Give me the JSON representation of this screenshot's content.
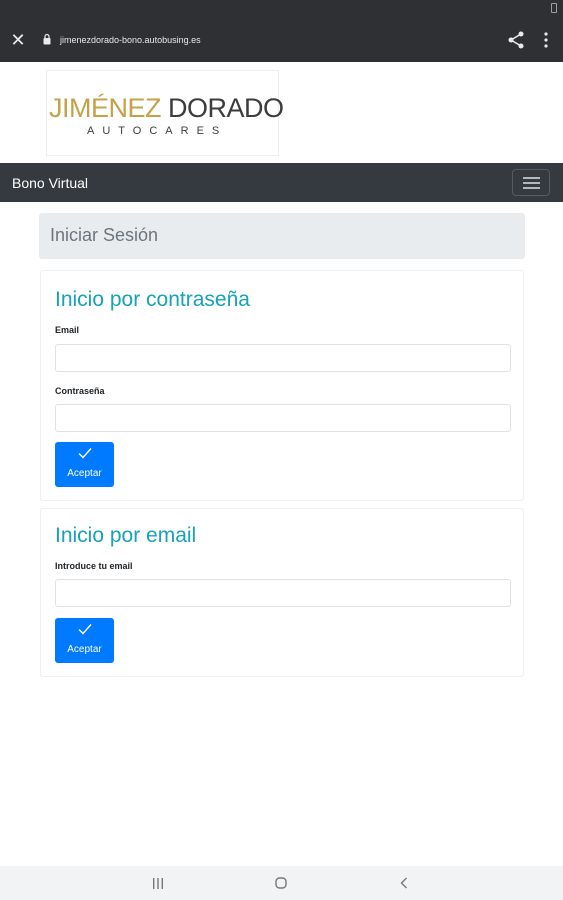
{
  "browser": {
    "url": "jimenezdorado-bono.autobusing.es"
  },
  "logo": {
    "main_gold": "JIMÉNEZ",
    "main_dark": "DORADO",
    "sub": "AUTOCARES"
  },
  "navbar": {
    "brand": "Bono Virtual"
  },
  "page": {
    "title": "Iniciar Sesión"
  },
  "password_login": {
    "heading": "Inicio por contraseña",
    "email_label": "Email",
    "email_value": "",
    "password_label": "Contraseña",
    "password_value": "",
    "submit_label": "Aceptar"
  },
  "email_login": {
    "heading": "Inicio por email",
    "email_label": "Introduce tu email",
    "email_value": "",
    "submit_label": "Aceptar"
  },
  "colors": {
    "navbar_bg": "#343a40",
    "heading_teal": "#17a2b8",
    "button_blue": "#007bff",
    "logo_gold": "#c7a04a"
  }
}
